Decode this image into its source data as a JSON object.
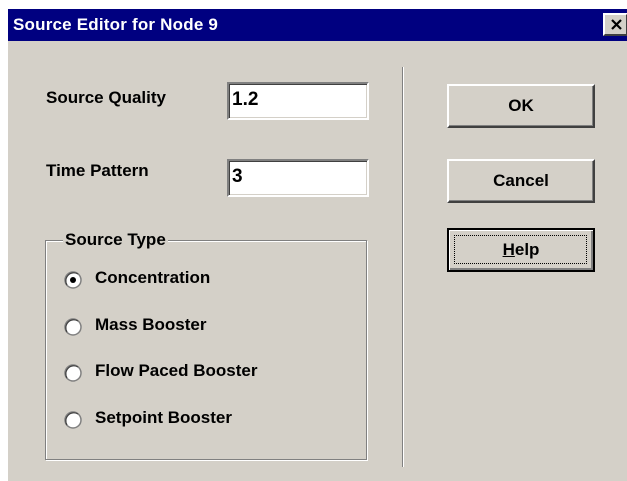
{
  "window": {
    "title": "Source Editor for Node 9"
  },
  "fields": {
    "source_quality": {
      "label": "Source Quality",
      "value": "1.2"
    },
    "time_pattern": {
      "label": "Time Pattern",
      "value": "3"
    }
  },
  "source_type": {
    "legend": "Source Type",
    "options": [
      {
        "label": "Concentration",
        "selected": true
      },
      {
        "label": "Mass Booster",
        "selected": false
      },
      {
        "label": "Flow Paced Booster",
        "selected": false
      },
      {
        "label": "Setpoint Booster",
        "selected": false
      }
    ]
  },
  "buttons": {
    "ok": "OK",
    "cancel": "Cancel",
    "help_mnemonic": "H",
    "help_rest": "elp"
  },
  "colors": {
    "titlebar": "#000080",
    "face": "#d4d0c8"
  },
  "icons": {
    "close": "close-icon"
  }
}
